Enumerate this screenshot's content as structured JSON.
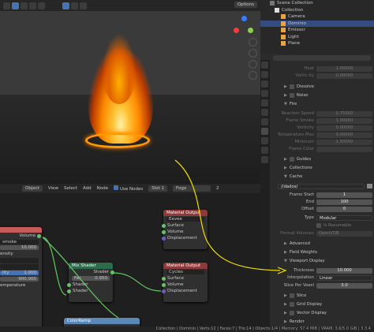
{
  "viewport": {
    "options_label": "Options"
  },
  "node_editor": {
    "header": {
      "object_label": "Object",
      "menus": [
        "View",
        "Select",
        "Add",
        "Node"
      ],
      "use_nodes": "Use Nodes",
      "slot": "Slot 1",
      "material": "Fogo",
      "users": "2"
    },
    "nodes": {
      "left": {
        "volume": "Volume",
        "field1": "10.000",
        "label2": "smoke",
        "label3": "ensity",
        "label4": "lity",
        "field_a": "1.000",
        "field_b": "900.000",
        "label5": "emperature"
      },
      "mix_shader": {
        "title": "Mix Shader",
        "out": "Shader",
        "fac_label": "Fac",
        "fac_value": "0.950",
        "in1": "Shader",
        "in2": "Shader"
      },
      "output_top": {
        "title": "Material Output",
        "target": "Eevee",
        "surface": "Surface",
        "volume": "Volume",
        "displacement": "Displacement"
      },
      "output_bottom": {
        "title": "Material Output",
        "target": "Cycles",
        "surface": "Surface",
        "volume": "Volume",
        "displacement": "Displacement"
      },
      "color_ramp": {
        "title": "ColorRamp"
      }
    }
  },
  "outliner": {
    "title": "Scene Collection",
    "items": [
      {
        "label": "Collection"
      },
      {
        "label": "Camera"
      },
      {
        "label": "Domínio"
      },
      {
        "label": "Emissor"
      },
      {
        "label": "Light"
      },
      {
        "label": "Plane"
      }
    ]
  },
  "properties": {
    "top_rows": [
      {
        "label": "Heat",
        "value": "1.00000"
      },
      {
        "label": "Vortic ity",
        "value": "0.00000"
      }
    ],
    "dissolve": "Dissolve",
    "noise": "Noise",
    "fire": "Fire",
    "fire_rows": [
      {
        "label": "Reaction Speed",
        "value": "0.75000"
      },
      {
        "label": "Flame Smoke",
        "value": "1.00000"
      },
      {
        "label": "Vorticity",
        "value": "0.00000"
      },
      {
        "label": "Temperature Max",
        "value": "3.00000"
      },
      {
        "label": "Minimum",
        "value": "1.50000"
      },
      {
        "label": "Flame Color",
        "value": ""
      }
    ],
    "guides": "Guides",
    "collections": "Collections",
    "cache": "Cache",
    "cache_path": "//dados/",
    "cache_rows": [
      {
        "label": "Frame Start",
        "value": "1"
      },
      {
        "label": "End",
        "value": "100"
      },
      {
        "label": "Offset",
        "value": "0"
      },
      {
        "label": "Type",
        "value": "Modular"
      }
    ],
    "is_resumable": "Is Resumable",
    "format_volumes": {
      "label": "Format Volumes",
      "value": "OpenVDB"
    },
    "advanced": "Advanced",
    "field_weights": "Field Weights",
    "viewport_display": "Viewport Display",
    "display_rows": [
      {
        "label": "Thickness",
        "value": "10.000"
      },
      {
        "label": "Interpolation",
        "value": "Linear"
      },
      {
        "label": "Slice Per Voxel",
        "value": "3.0"
      }
    ],
    "slice": "Slice",
    "grid_display": "Grid Display",
    "vector_display": "Vector Display",
    "render": "Render"
  },
  "status_bar": "Collection | Domínio | Verts:12 | Faces:7 | Tris:14 | Objects:1/4 | Memory: 57.4 MiB | VRAM: 3.6/5.0 GiB | 3.3.4",
  "annotation_color": "#f5e000"
}
